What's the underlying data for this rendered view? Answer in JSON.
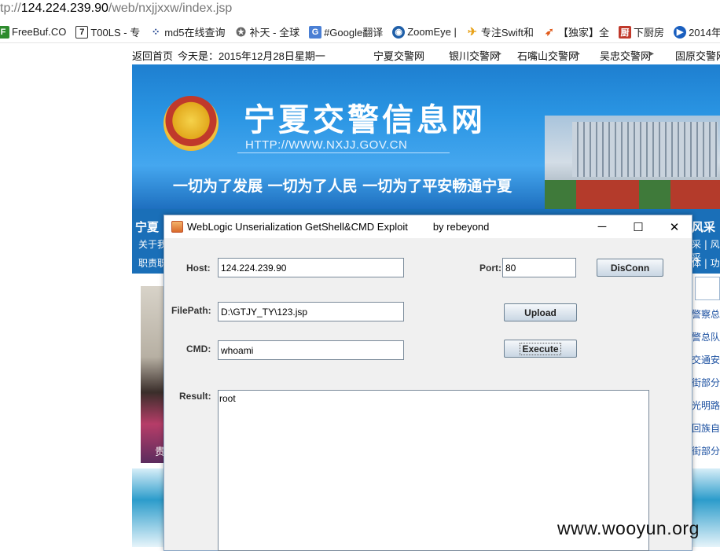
{
  "browser": {
    "address": {
      "prefix": "tp://",
      "host": "124.224.239.90",
      "path": "/web/nxjjxxw/index.jsp"
    },
    "bookmarks": [
      {
        "label": "FreeBuf.CO",
        "icon": "freebuf-icon",
        "color": "#2e8b2e"
      },
      {
        "label": "T00LS - 专",
        "icon": "tools-icon",
        "color": "#333333"
      },
      {
        "label": "md5在线查询",
        "icon": "grid-icon",
        "color": "#1a3e8c"
      },
      {
        "label": "补天 - 全球",
        "icon": "star-icon",
        "color": "#666666"
      },
      {
        "label": "#Google翻译",
        "icon": "google-translate-icon",
        "color": "#4a7fd4"
      },
      {
        "label": "ZoomEye |",
        "icon": "eye-icon",
        "color": "#1f5fa8"
      },
      {
        "label": "专注Swift和",
        "icon": "swift-icon",
        "color": "#e8a21a"
      },
      {
        "label": "【独家】全",
        "icon": "arrow-icon",
        "color": "#e05a1a"
      },
      {
        "label": "下厨房",
        "icon": "kitchen-icon",
        "color": "#c0392b"
      },
      {
        "label": "2014年",
        "icon": "play-icon",
        "color": "#1a5fbf"
      }
    ]
  },
  "webpage": {
    "topnav": {
      "home": "返回首页",
      "date": "今天是：2015年12月28日星期一",
      "links": [
        "宁夏交警网",
        "银川交警网",
        "石嘴山交警网",
        "吴忠交警网",
        "固原交警网"
      ]
    },
    "banner": {
      "title": "宁夏交警信息网",
      "url": "HTTP://WWW.NXJJ.GOV.CN",
      "slogan": "一切为了发展  一切为了人民  一切为了平安畅通宁夏"
    },
    "bluebar": {
      "left_title": "宁夏",
      "left_line2": "关于我",
      "left_line3": "职责职",
      "right_title": "风采",
      "right_line2": "采 | 风采",
      "right_line3": "体 | 功"
    },
    "photo_caption": "贵",
    "right_list": [
      "警察总队",
      "警总队",
      "交通安",
      "街部分",
      "光明路",
      "回族自治",
      "街部分"
    ]
  },
  "dialog": {
    "title": "WebLogic Unserialization GetShell&CMD Exploit",
    "author": "by rebeyond",
    "controls": {
      "minimize": "─",
      "maximize": "☐",
      "close": "✕"
    },
    "host_label": "Host:",
    "host_value": "124.224.239.90",
    "port_label": "Port:",
    "port_value": "80",
    "disconn_label": "DisConn",
    "filepath_label": "FilePath:",
    "filepath_value": "D:\\GTJY_TY\\123.jsp",
    "upload_label": "Upload",
    "cmd_label": "CMD:",
    "cmd_value": "whoami",
    "execute_label": "Execute",
    "result_label": "Result:",
    "result_value": "root"
  },
  "watermark": "www.wooyun.org"
}
